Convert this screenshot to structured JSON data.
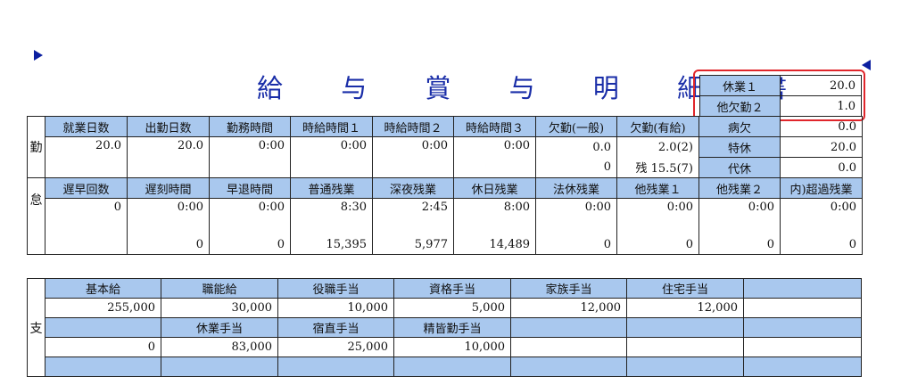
{
  "title": "給 与 賞 与 明 細 書",
  "leave_box": [
    {
      "label": "休業１",
      "value": "20.0"
    },
    {
      "label": "他欠勤２",
      "value": "1.0"
    }
  ],
  "attendance": {
    "side_label_1": "勤",
    "side_label_2": "怠",
    "row1_headers": [
      "就業日数",
      "出勤日数",
      "勤務時間",
      "時給時間１",
      "時給時間２",
      "時給時間３",
      "欠勤(一般)",
      "欠勤(有給)"
    ],
    "row1_values": [
      "20.0",
      "20.0",
      "0:00",
      "0:00",
      "0:00",
      "0:00",
      "0.0",
      "2.0(2)"
    ],
    "absence_general_sub": "0",
    "absence_paid_sub": "残 15.5(7)",
    "right_rows": [
      {
        "label": "病欠",
        "value": "0.0"
      },
      {
        "label": "特休",
        "value": "20.0"
      },
      {
        "label": "代休",
        "value": "0.0"
      }
    ],
    "row2_headers": [
      "遅早回数",
      "遅刻時間",
      "早退時間",
      "普通残業",
      "深夜残業",
      "休日残業",
      "法休残業",
      "他残業１",
      "他残業２",
      "内)超過残業"
    ],
    "row2_values": [
      "0",
      "0:00",
      "0:00",
      "8:30",
      "2:45",
      "8:00",
      "0:00",
      "0:00",
      "0:00",
      "0:00"
    ],
    "row2_amounts": [
      "",
      "0",
      "0",
      "15,395",
      "5,977",
      "14,489",
      "0",
      "0",
      "0",
      "0"
    ]
  },
  "payment": {
    "side_label": "支",
    "row1_headers": [
      "基本給",
      "職能給",
      "役職手当",
      "資格手当",
      "家族手当",
      "住宅手当",
      ""
    ],
    "row1_values": [
      "255,000",
      "30,000",
      "10,000",
      "5,000",
      "12,000",
      "12,000",
      ""
    ],
    "row2_headers": [
      "",
      "休業手当",
      "宿直手当",
      "精皆勤手当",
      "",
      "",
      ""
    ],
    "row2_values": [
      "0",
      "83,000",
      "25,000",
      "10,000",
      "",
      "",
      ""
    ]
  }
}
